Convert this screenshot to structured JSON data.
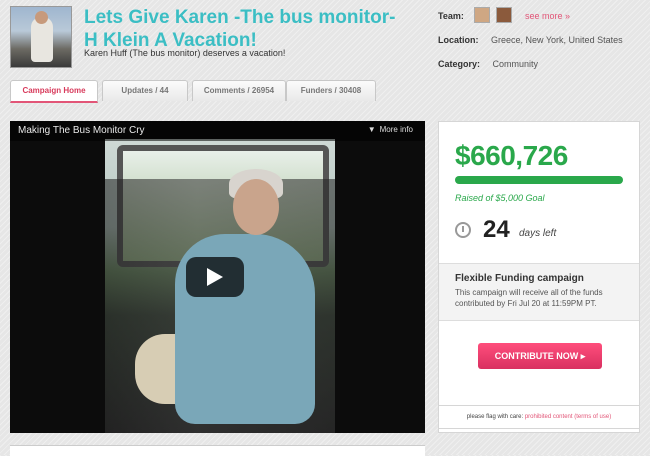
{
  "header": {
    "title": "Lets Give Karen -The bus monitor- H Klein A Vacation!",
    "subtitle": "Karen Huff (The bus monitor) deserves a vacation!",
    "team_label": "Team:",
    "see_more": "see more »",
    "location_label": "Location:",
    "location_value": "Greece, New York, United States",
    "category_label": "Category:",
    "category_value": "Community"
  },
  "tabs": [
    {
      "label": "Campaign Home"
    },
    {
      "label": "Updates / 44"
    },
    {
      "label": "Comments / 26954"
    },
    {
      "label": "Funders / 30408"
    }
  ],
  "video": {
    "title": "Making The Bus Monitor Cry",
    "more_info": "More info"
  },
  "campaign": {
    "amount": "$660,726",
    "progress_fraction": 1.0,
    "raised_text": "Raised of $5,000 Goal",
    "days_left_number": "24",
    "days_left_label": "days left",
    "flexible_title": "Flexible Funding campaign",
    "flexible_text": "This campaign will receive all of the funds contributed by Fri Jul 20 at 11:59PM PT.",
    "contribute_label": "CONTRIBUTE NOW ▸"
  },
  "flag": {
    "prefix": "please flag with care:",
    "link1": "prohibited content",
    "link2": "(terms of use)"
  },
  "colors": {
    "accent_teal": "#3bbec4",
    "brand_pink": "#e25577",
    "money_green": "#2aa84b"
  }
}
